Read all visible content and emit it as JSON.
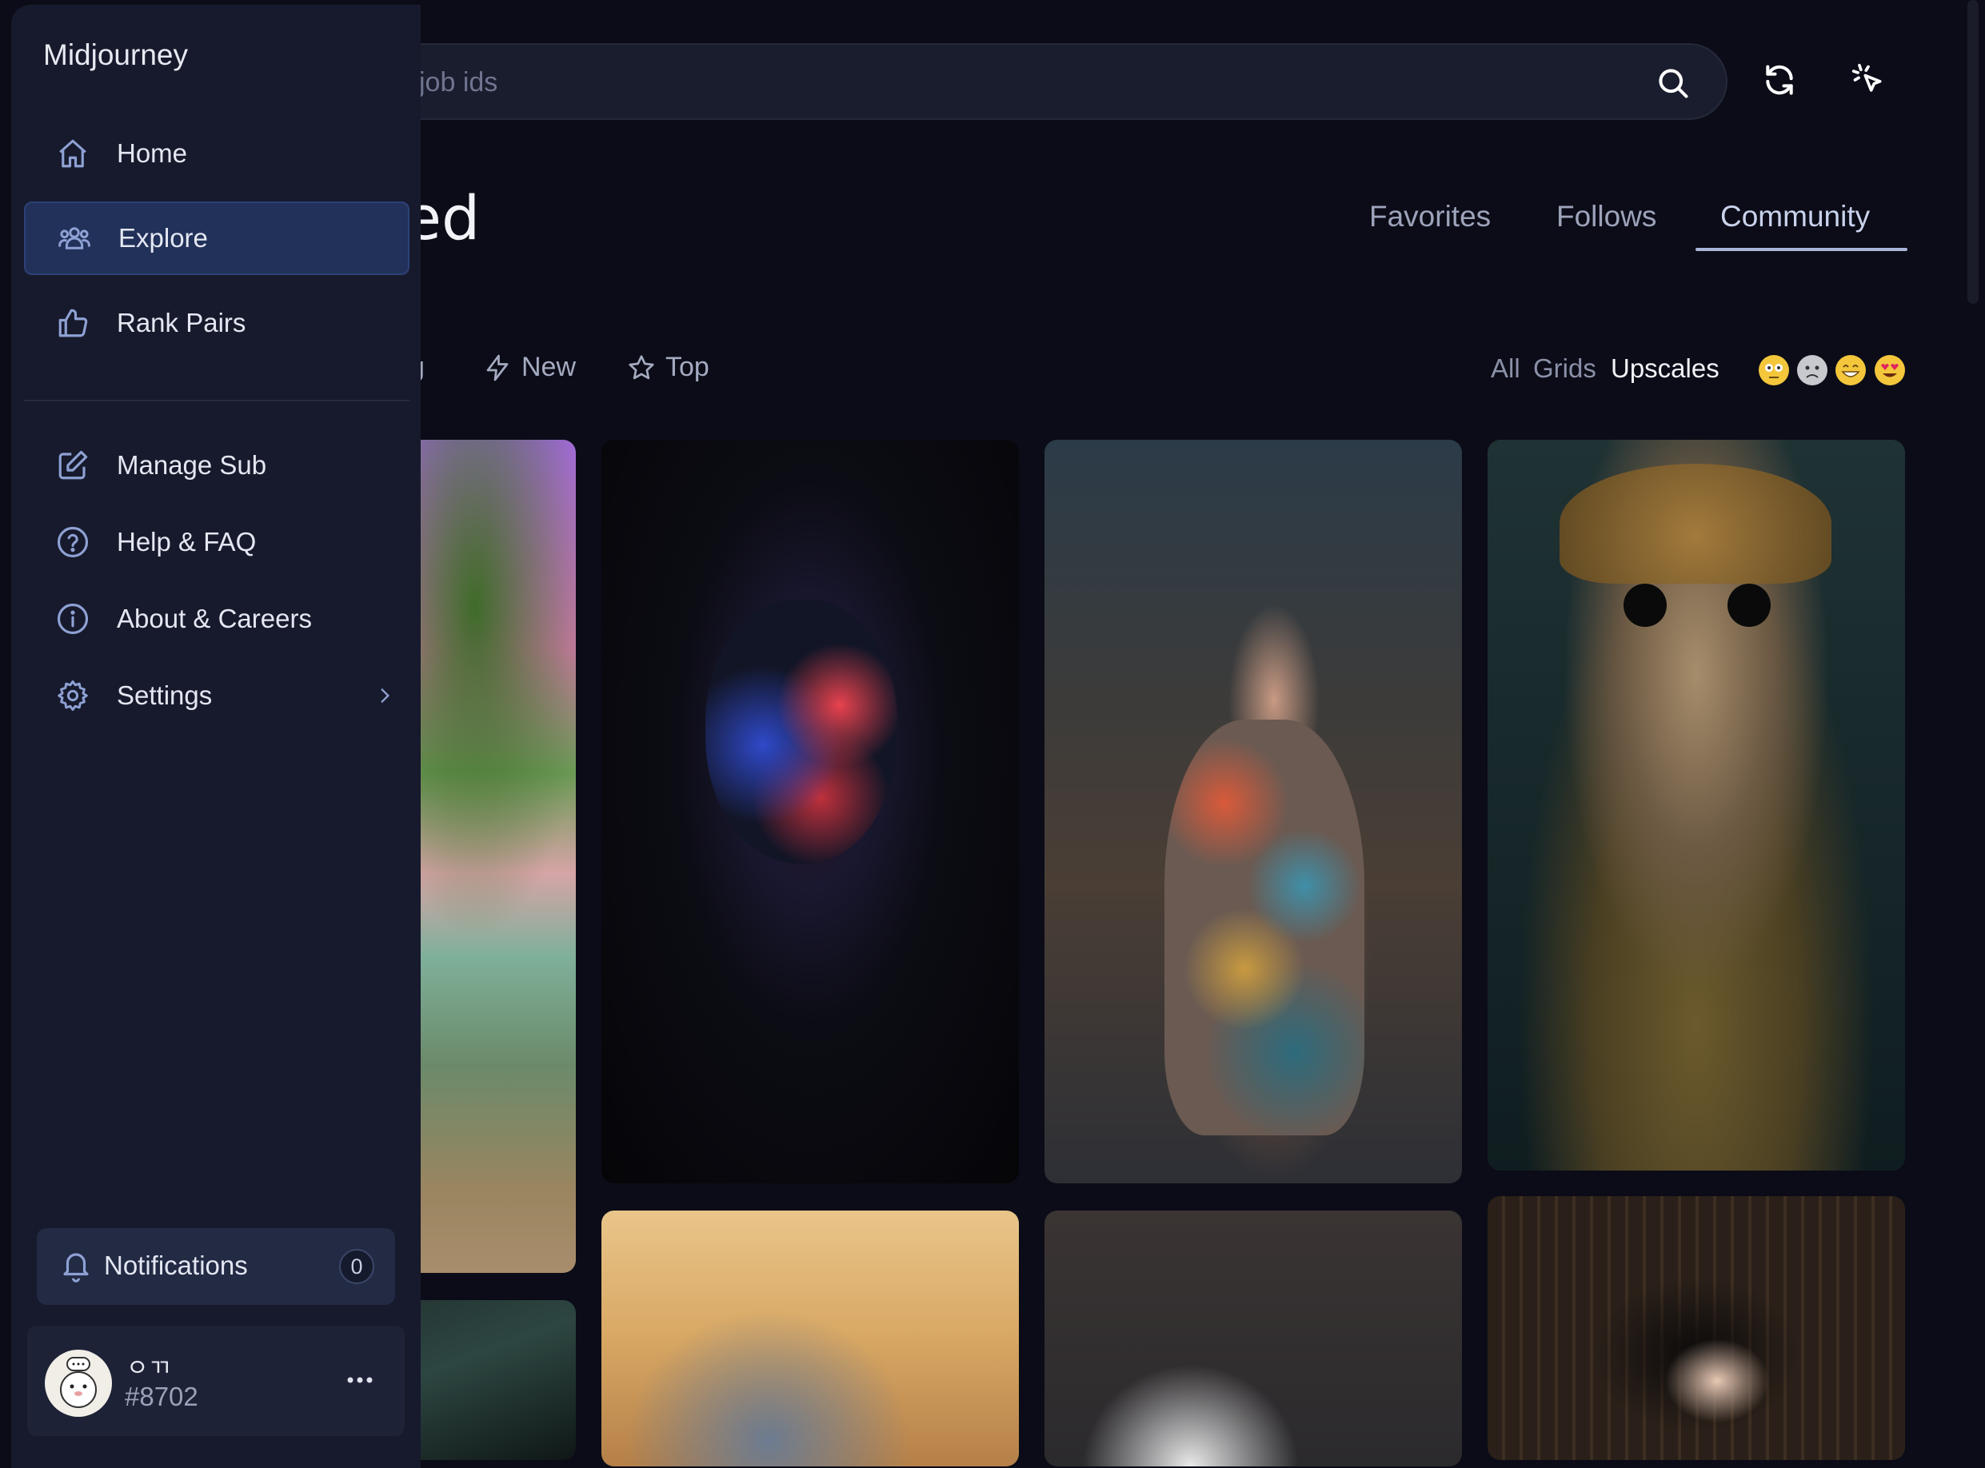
{
  "app": {
    "brand": "Midjourney"
  },
  "search": {
    "placeholder": "job ids"
  },
  "header": {
    "title": "ty Feed"
  },
  "feed_tabs": [
    {
      "label": "Favorites",
      "active": false
    },
    {
      "label": "Follows",
      "active": false
    },
    {
      "label": "Community",
      "active": true
    }
  ],
  "sort": {
    "partial": "g",
    "new": "New",
    "top": "Top"
  },
  "filters": {
    "all": "All",
    "grids": "Grids",
    "upscales": "Upscales",
    "active": "Upscales"
  },
  "reactions": [
    "neutral-face-icon",
    "frown-face-icon",
    "grin-face-icon",
    "heart-eyes-face-icon"
  ],
  "sidebar": {
    "items": [
      {
        "label": "Home",
        "icon": "home-icon"
      },
      {
        "label": "Explore",
        "icon": "people-icon",
        "active": true
      },
      {
        "label": "Rank Pairs",
        "icon": "thumbs-up-icon"
      },
      {
        "label": "Manage Sub",
        "icon": "edit-icon"
      },
      {
        "label": "Help & FAQ",
        "icon": "help-icon"
      },
      {
        "label": "About & Careers",
        "icon": "info-icon"
      },
      {
        "label": "Settings",
        "icon": "gear-icon"
      }
    ],
    "notifications": {
      "label": "Notifications",
      "count": "0"
    },
    "user": {
      "name": "ㅇㄲ",
      "tag": "#8702"
    }
  },
  "colors": {
    "background": "#0b0c17",
    "sidebar": "#171a2c",
    "active_nav": "#223159",
    "accent": "#aab6d8"
  }
}
